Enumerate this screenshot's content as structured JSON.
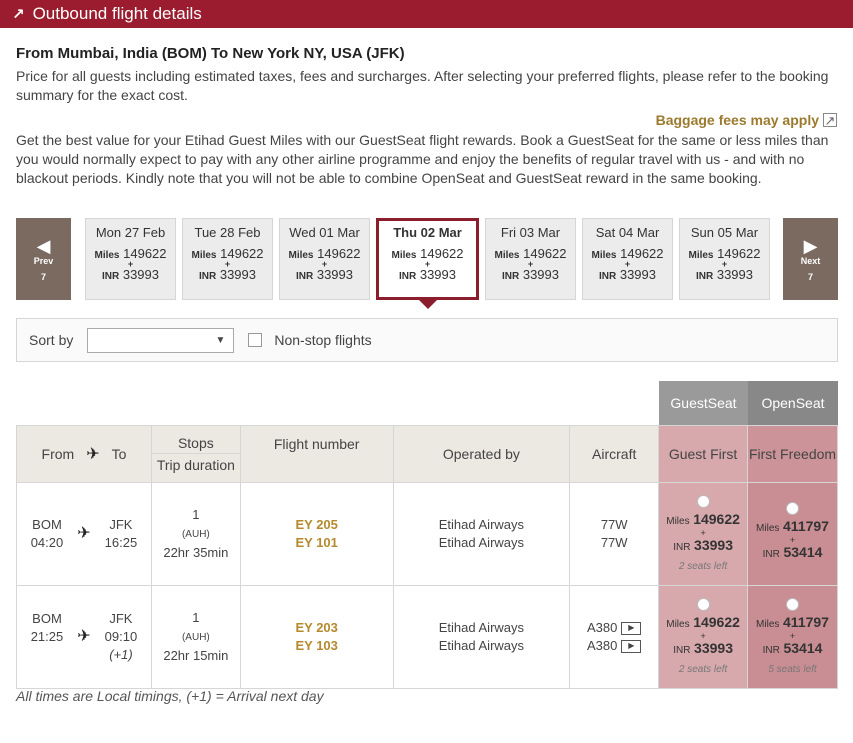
{
  "header": {
    "title": "Outbound flight details",
    "icon": "arrow-up-right-icon",
    "color": "#9b1c2e"
  },
  "route_title": "From Mumbai, India (BOM) To New York NY, USA (JFK)",
  "price_note": "Price for all guests including estimated taxes, fees and surcharges. After selecting your preferred flights, please refer to the booking summary for the exact cost.",
  "baggage_link": "Baggage fees may apply",
  "guestseat_note": "Get the best value for your Etihad Guest Miles with our GuestSeat flight rewards. Book a GuestSeat for the same or less miles than you would normally expect to pay with any other airline programme and enjoy the benefits of regular travel with us - and with no blackout periods. Kindly note that you will not be able to combine OpenSeat and GuestSeat reward in the same booking.",
  "nav": {
    "prev": {
      "label": "Prev",
      "count": "7"
    },
    "next": {
      "label": "Next",
      "count": "7"
    }
  },
  "dates": [
    {
      "day": "Mon 27 Feb",
      "miles_label": "Miles",
      "miles": "149622",
      "plus": "+",
      "inr_label": "INR",
      "inr": "33993"
    },
    {
      "day": "Tue 28 Feb",
      "miles_label": "Miles",
      "miles": "149622",
      "plus": "+",
      "inr_label": "INR",
      "inr": "33993"
    },
    {
      "day": "Wed 01 Mar",
      "miles_label": "Miles",
      "miles": "149622",
      "plus": "+",
      "inr_label": "INR",
      "inr": "33993"
    },
    {
      "day": "Thu 02 Mar",
      "miles_label": "Miles",
      "miles": "149622",
      "plus": "+",
      "inr_label": "INR",
      "inr": "33993"
    },
    {
      "day": "Fri 03 Mar",
      "miles_label": "Miles",
      "miles": "149622",
      "plus": "+",
      "inr_label": "INR",
      "inr": "33993"
    },
    {
      "day": "Sat 04 Mar",
      "miles_label": "Miles",
      "miles": "149622",
      "plus": "+",
      "inr_label": "INR",
      "inr": "33993"
    },
    {
      "day": "Sun 05 Mar",
      "miles_label": "Miles",
      "miles": "149622",
      "plus": "+",
      "inr_label": "INR",
      "inr": "33993"
    }
  ],
  "selected_date_index": 3,
  "filters": {
    "sort_label": "Sort by",
    "sort_value": "",
    "nonstop_label": "Non-stop flights"
  },
  "cabin_groups": {
    "guestseat": "GuestSeat",
    "openseat": "OpenSeat"
  },
  "table_headers": {
    "from": "From",
    "to": "To",
    "stops": "Stops",
    "trip_duration": "Trip duration",
    "flight_number": "Flight number",
    "operated_by": "Operated by",
    "aircraft": "Aircraft",
    "guest_first": "Guest First",
    "first_freedom": "First Freedom"
  },
  "flights": [
    {
      "from_code": "BOM",
      "from_time": "04:20",
      "to_code": "JFK",
      "to_time": "16:25",
      "arrival_offset": "",
      "stops": "1",
      "via": "(AUH)",
      "duration": "22hr 35min",
      "flight_1": "EY 205",
      "flight_2": "EY 101",
      "operator_1": "Etihad Airways",
      "operator_2": "Etihad Airways",
      "aircraft_1": "77W",
      "aircraft_2": "77W",
      "gs": {
        "miles_label": "Miles",
        "miles": "149622",
        "plus": "+",
        "inr_label": "INR",
        "inr": "33993",
        "seats": "2 seats left"
      },
      "os": {
        "miles_label": "Miles",
        "miles": "411797",
        "plus": "+",
        "inr_label": "INR",
        "inr": "53414",
        "seats": ""
      }
    },
    {
      "from_code": "BOM",
      "from_time": "21:25",
      "to_code": "JFK",
      "to_time": "09:10",
      "arrival_offset": "(+1)",
      "stops": "1",
      "via": "(AUH)",
      "duration": "22hr 15min",
      "flight_1": "EY 203",
      "flight_2": "EY 103",
      "operator_1": "Etihad Airways",
      "operator_2": "Etihad Airways",
      "aircraft_1": "A380",
      "aircraft_2": "A380",
      "gs": {
        "miles_label": "Miles",
        "miles": "149622",
        "plus": "+",
        "inr_label": "INR",
        "inr": "33993",
        "seats": "2 seats left"
      },
      "os": {
        "miles_label": "Miles",
        "miles": "411797",
        "plus": "+",
        "inr_label": "INR",
        "inr": "53414",
        "seats": "5 seats left"
      }
    }
  ],
  "footnote": "All times are Local timings, (+1) = Arrival next day"
}
